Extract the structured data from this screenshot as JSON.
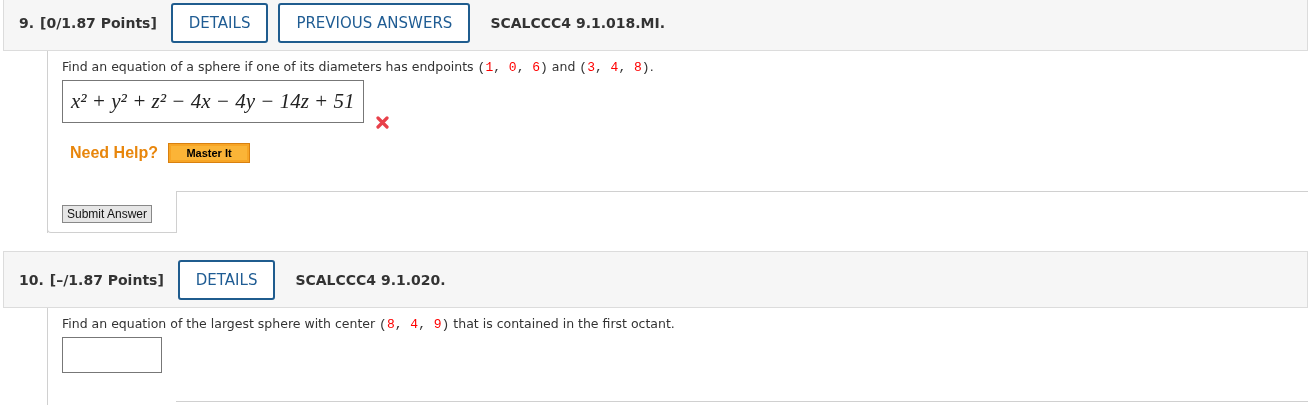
{
  "questions": [
    {
      "number": "9.",
      "points": "[0/1.87 Points]",
      "buttons": [
        "DETAILS",
        "PREVIOUS ANSWERS"
      ],
      "code": "SCALCCC4 9.1.018.MI.",
      "prompt": [
        {
          "kind": "text",
          "text": "Find an equation of a sphere if one of its diameters has endpoints "
        },
        {
          "kind": "mono",
          "text": "("
        },
        {
          "kind": "value",
          "text": "1"
        },
        {
          "kind": "mono",
          "text": ", "
        },
        {
          "kind": "value",
          "text": "0"
        },
        {
          "kind": "mono",
          "text": ", "
        },
        {
          "kind": "value",
          "text": "6"
        },
        {
          "kind": "mono",
          "text": ")"
        },
        {
          "kind": "text",
          "text": " and "
        },
        {
          "kind": "mono",
          "text": "("
        },
        {
          "kind": "value",
          "text": "3"
        },
        {
          "kind": "mono",
          "text": ", "
        },
        {
          "kind": "value",
          "text": "4"
        },
        {
          "kind": "mono",
          "text": ", "
        },
        {
          "kind": "value",
          "text": "8"
        },
        {
          "kind": "mono",
          "text": ")"
        },
        {
          "kind": "text",
          "text": "."
        }
      ],
      "answer": {
        "value": "x² + y² + z² − 4x − 4y − 14z + 51",
        "incorrect": true
      },
      "help": {
        "label": "Need Help?",
        "buttons": [
          "Master It"
        ]
      },
      "submit": "Submit Answer"
    },
    {
      "number": "10.",
      "points": "[–/1.87 Points]",
      "buttons": [
        "DETAILS"
      ],
      "code": "SCALCCC4 9.1.020.",
      "prompt": [
        {
          "kind": "text",
          "text": "Find an equation of the largest sphere with center "
        },
        {
          "kind": "mono",
          "text": "("
        },
        {
          "kind": "value",
          "text": "8"
        },
        {
          "kind": "mono",
          "text": ", "
        },
        {
          "kind": "value",
          "text": "4"
        },
        {
          "kind": "mono",
          "text": ", "
        },
        {
          "kind": "value",
          "text": "9"
        },
        {
          "kind": "mono",
          "text": ")"
        },
        {
          "kind": "text",
          "text": " that is contained in the first octant."
        }
      ],
      "answer": {
        "incorrect": false
      }
    }
  ]
}
